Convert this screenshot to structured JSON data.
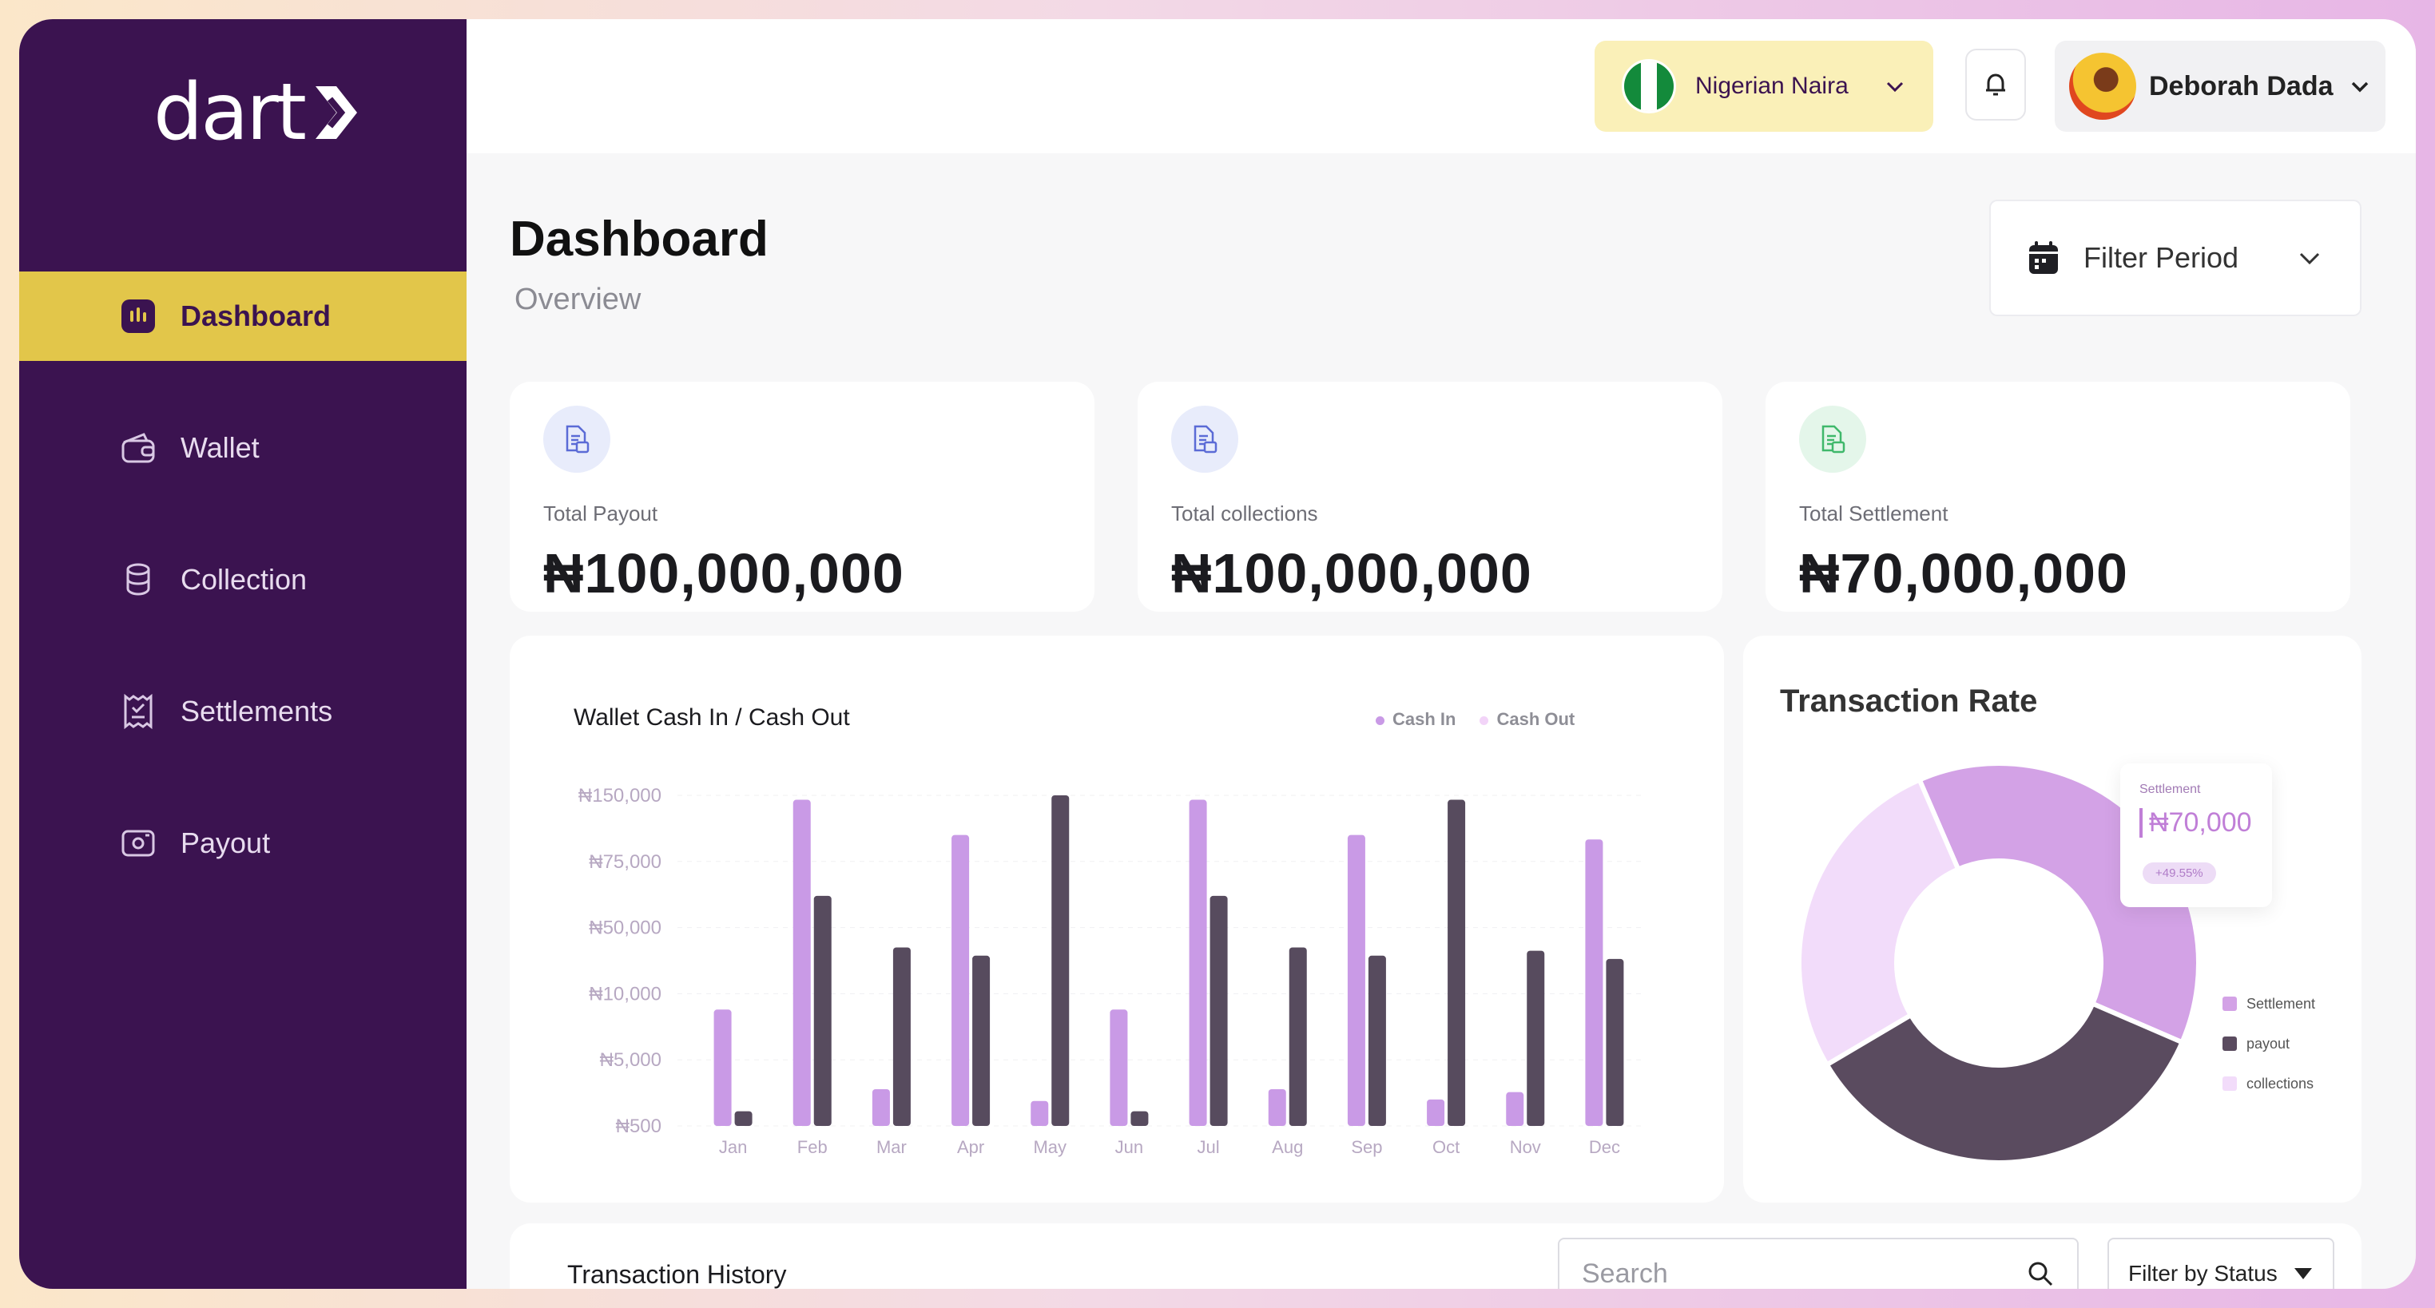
{
  "app": {
    "logo_text": "dart"
  },
  "sidebar": {
    "items": [
      {
        "label": "Dashboard",
        "icon": "dashboard-icon",
        "active": true
      },
      {
        "label": "Wallet",
        "icon": "wallet-icon",
        "active": false
      },
      {
        "label": "Collection",
        "icon": "coins-icon",
        "active": false
      },
      {
        "label": "Settlements",
        "icon": "receipt-icon",
        "active": false
      },
      {
        "label": "Payout",
        "icon": "payout-icon",
        "active": false
      }
    ]
  },
  "topbar": {
    "currency": "Nigerian Naira",
    "user_name": "Deborah Dada"
  },
  "header": {
    "title": "Dashboard",
    "subtitle": "Overview",
    "filter_label": "Filter Period"
  },
  "stats": [
    {
      "label": "Total Payout",
      "value": "₦100,000,000",
      "icon_color": "#5b6bd6",
      "icon_bg": "#e8ecfb"
    },
    {
      "label": "Total collections",
      "value": "₦100,000,000",
      "icon_color": "#5b6bd6",
      "icon_bg": "#e8ecfb"
    },
    {
      "label": "Total Settlement",
      "value": "₦70,000,000",
      "icon_color": "#3fb86b",
      "icon_bg": "#e4f6ea"
    }
  ],
  "chart_data": [
    {
      "type": "bar",
      "title": "Wallet Cash In  / Cash Out",
      "legend_position": "top-right",
      "y_ticks": [
        "₦150,000",
        "₦75,000",
        "₦50,000",
        "₦10,000",
        "₦5,000",
        "₦500"
      ],
      "categories": [
        "Jan",
        "Feb",
        "Mar",
        "Apr",
        "May",
        "Jun",
        "Jul",
        "Aug",
        "Sep",
        "Oct",
        "Nov",
        "Dec"
      ],
      "scale_note_hidden": true,
      "series": [
        {
          "name": "Cash In",
          "color": "#c99ae6",
          "values": [
            8800,
            145000,
            3000,
            105000,
            2200,
            8800,
            145000,
            3000,
            105000,
            2300,
            2800,
            100000
          ]
        },
        {
          "name": "Cash Out",
          "color": "#574b5e",
          "values": [
            1500,
            62000,
            38000,
            33000,
            150000,
            1500,
            62000,
            38000,
            33000,
            145000,
            36000,
            31000
          ]
        }
      ]
    },
    {
      "type": "pie",
      "title": "Transaction Rate",
      "legend_position": "right",
      "series": [
        {
          "name": "Settlement",
          "value": 38,
          "color": "#d3a2e6"
        },
        {
          "name": "payout",
          "value": 35,
          "color": "#5a4b5f"
        },
        {
          "name": "collections",
          "value": 27,
          "color": "#f2dcfa"
        }
      ]
    }
  ],
  "pie_tooltip": {
    "label": "Settlement",
    "value": "₦70,000",
    "change": "+49.55%"
  },
  "transactions": {
    "title": "Transaction History",
    "search_placeholder": "Search",
    "status_filter": "Filter by Status"
  }
}
